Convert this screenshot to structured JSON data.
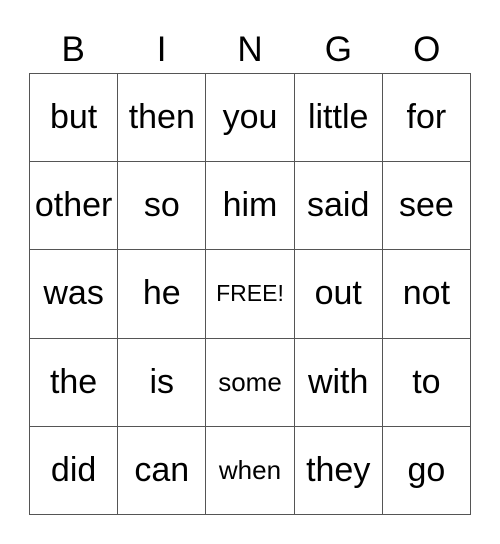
{
  "header": [
    "B",
    "I",
    "N",
    "G",
    "O"
  ],
  "cells": [
    [
      "but",
      "then",
      "you",
      "little",
      "for"
    ],
    [
      "other",
      "so",
      "him",
      "said",
      "see"
    ],
    [
      "was",
      "he",
      "FREE!",
      "out",
      "not"
    ],
    [
      "the",
      "is",
      "some",
      "with",
      "to"
    ],
    [
      "did",
      "can",
      "when",
      "they",
      "go"
    ]
  ]
}
